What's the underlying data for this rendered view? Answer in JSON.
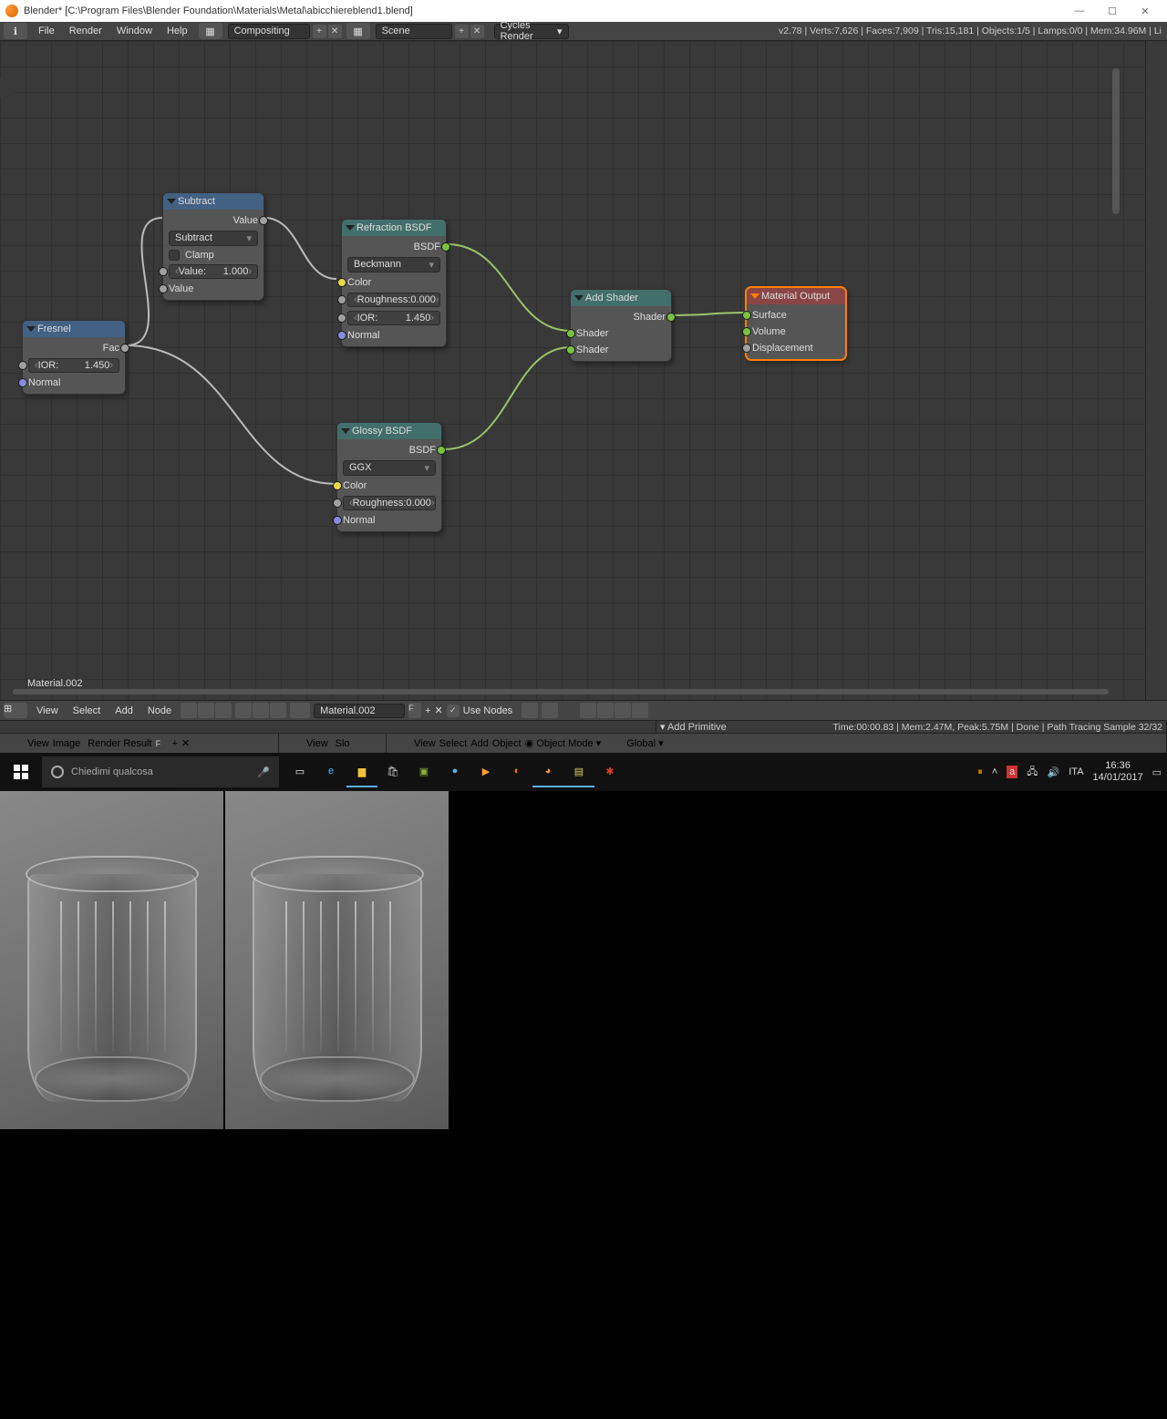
{
  "titlebar": {
    "appname": "Blender*",
    "filepath": "[C:\\Program Files\\Blender Foundation\\Materials\\Metal\\abicchiereblend1.blend]",
    "min": "—",
    "max": "☐",
    "close": "✕"
  },
  "menubar": {
    "items": [
      "File",
      "Render",
      "Window",
      "Help"
    ],
    "layout": "Compositing",
    "scene": "Scene",
    "engine": "Cycles Render",
    "stats": "v2.78 | Verts:7,626 | Faces:7,909 | Tris:15,181 | Objects:1/5 | Lamps:0/0 | Mem:34.96M | Li"
  },
  "nodes": {
    "fresnel": {
      "title": "Fresnel",
      "fac": "Fac",
      "ior_label": "IOR:",
      "ior_val": "1.450",
      "normal": "Normal"
    },
    "subtract": {
      "title": "Subtract",
      "value_out": "Value",
      "mode": "Subtract",
      "clamp": "Clamp",
      "value_label": "Value:",
      "value_num": "1.000",
      "value_in": "Value"
    },
    "refraction": {
      "title": "Refraction BSDF",
      "out": "BSDF",
      "distribution": "Beckmann",
      "color": "Color",
      "rough_label": "Roughness:",
      "rough_val": "0.000",
      "ior_label": "IOR:",
      "ior_val": "1.450",
      "normal": "Normal"
    },
    "glossy": {
      "title": "Glossy BSDF",
      "out": "BSDF",
      "distribution": "GGX",
      "color": "Color",
      "rough_label": "Roughness:",
      "rough_val": "0.000",
      "normal": "Normal"
    },
    "addshader": {
      "title": "Add Shader",
      "out": "Shader",
      "in1": "Shader",
      "in2": "Shader"
    },
    "output": {
      "title": "Material Output",
      "surface": "Surface",
      "volume": "Volume",
      "displacement": "Displacement"
    }
  },
  "material_label": "Material.002",
  "node_toolbar": {
    "menus": [
      "View",
      "Select",
      "Add",
      "Node"
    ],
    "material": "Material.002",
    "use_nodes": "Use Nodes",
    "F": "F"
  },
  "splitbar": {
    "left_menus": [
      "View",
      "Image"
    ],
    "left_pill": "Render Result",
    "left_f": "F",
    "mid_view": "View",
    "mid_slot": "Slo",
    "right_menus": [
      "View",
      "Select",
      "Add",
      "Object"
    ],
    "right_mode": "Object Mode",
    "right_orient": "Global",
    "add_primitive": "Add Primitive",
    "render_stats": "Time:00:00.83 | Mem:2.47M, Peak:5.75M | Done | Path Tracing Sample 32/32"
  },
  "taskbar": {
    "search_placeholder": "Chiedimi qualcosa",
    "lang": "ITA",
    "time": "16:36",
    "date": "14/01/2017"
  }
}
